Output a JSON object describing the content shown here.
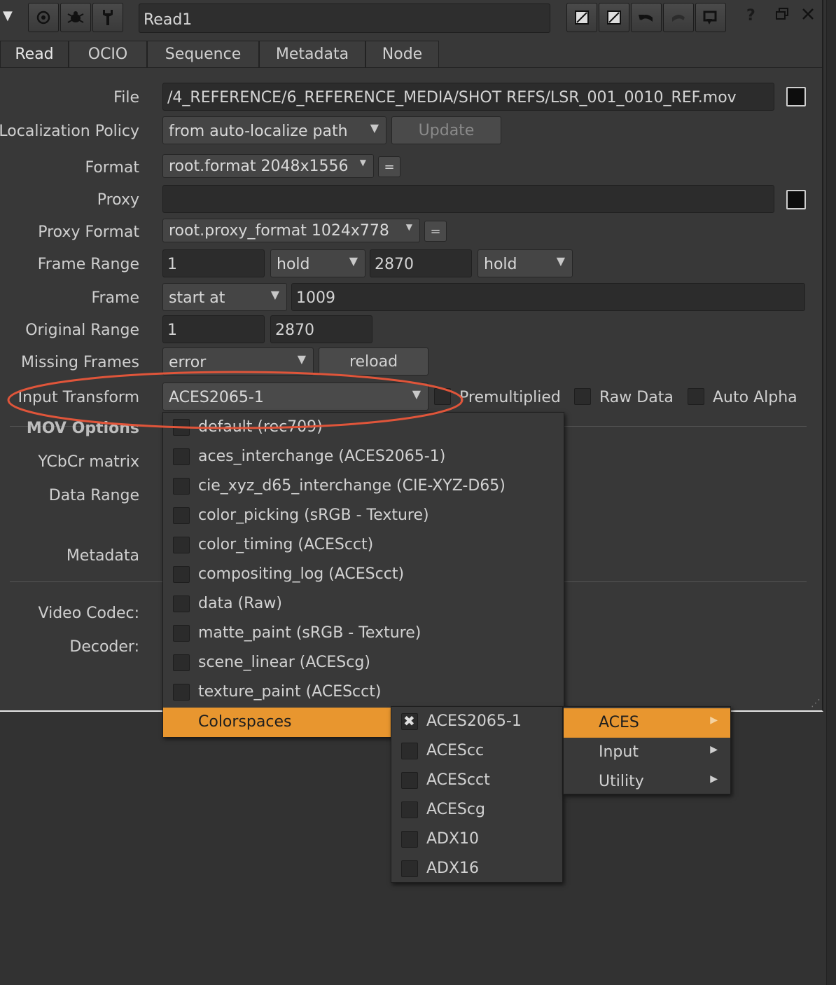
{
  "toolbar": {
    "node_name": "Read1",
    "help_label": "?"
  },
  "tabs": [
    "Read",
    "OCIO",
    "Sequence",
    "Metadata",
    "Node"
  ],
  "labels": {
    "file": "File",
    "localization_policy": "Localization Policy",
    "format": "Format",
    "proxy": "Proxy",
    "proxy_format": "Proxy Format",
    "frame_range": "Frame Range",
    "frame": "Frame",
    "original_range": "Original Range",
    "missing_frames": "Missing Frames",
    "input_transform": "Input Transform",
    "mov_options": "MOV Options",
    "ycbcr_matrix": "YCbCr matrix",
    "data_range": "Data Range",
    "metadata": "Metadata",
    "video_codec": "Video Codec:",
    "decoder": "Decoder:"
  },
  "values": {
    "file": "/4_REFERENCE/6_REFERENCE_MEDIA/SHOT REFS/LSR_001_0010_REF.mov",
    "localization_policy": "from auto-localize path",
    "update_button": "Update",
    "format": "root.format 2048x1556",
    "format_eq": "=",
    "proxy": "",
    "proxy_format": "root.proxy_format 1024x778",
    "proxy_eq": "=",
    "frame_range_start": "1",
    "frame_range_start_mode": "hold",
    "frame_range_end": "2870",
    "frame_range_end_mode": "hold",
    "frame_mode": "start at",
    "frame_value": "1009",
    "original_range_start": "1",
    "original_range_end": "2870",
    "missing_frames": "error",
    "reload_button": "reload",
    "input_transform": "ACES2065-1",
    "premultiplied": "Premultiplied",
    "raw_data": "Raw Data",
    "auto_alpha": "Auto Alpha"
  },
  "menu_main": [
    "default (rec709)",
    "aces_interchange (ACES2065-1)",
    "cie_xyz_d65_interchange (CIE-XYZ-D65)",
    "color_picking (sRGB - Texture)",
    "color_timing (ACEScct)",
    "compositing_log (ACEScct)",
    "data (Raw)",
    "matte_paint (sRGB - Texture)",
    "scene_linear (ACEScg)",
    "texture_paint (ACEScct)",
    "Colorspaces"
  ],
  "menu_aces": [
    "ACES2065-1",
    "ACEScc",
    "ACEScct",
    "ACEScg",
    "ADX10",
    "ADX16"
  ],
  "menu_categories": [
    "ACES",
    "Input",
    "Utility"
  ],
  "colors": {
    "highlight": "#e8962f",
    "annotation": "#e0553a"
  }
}
